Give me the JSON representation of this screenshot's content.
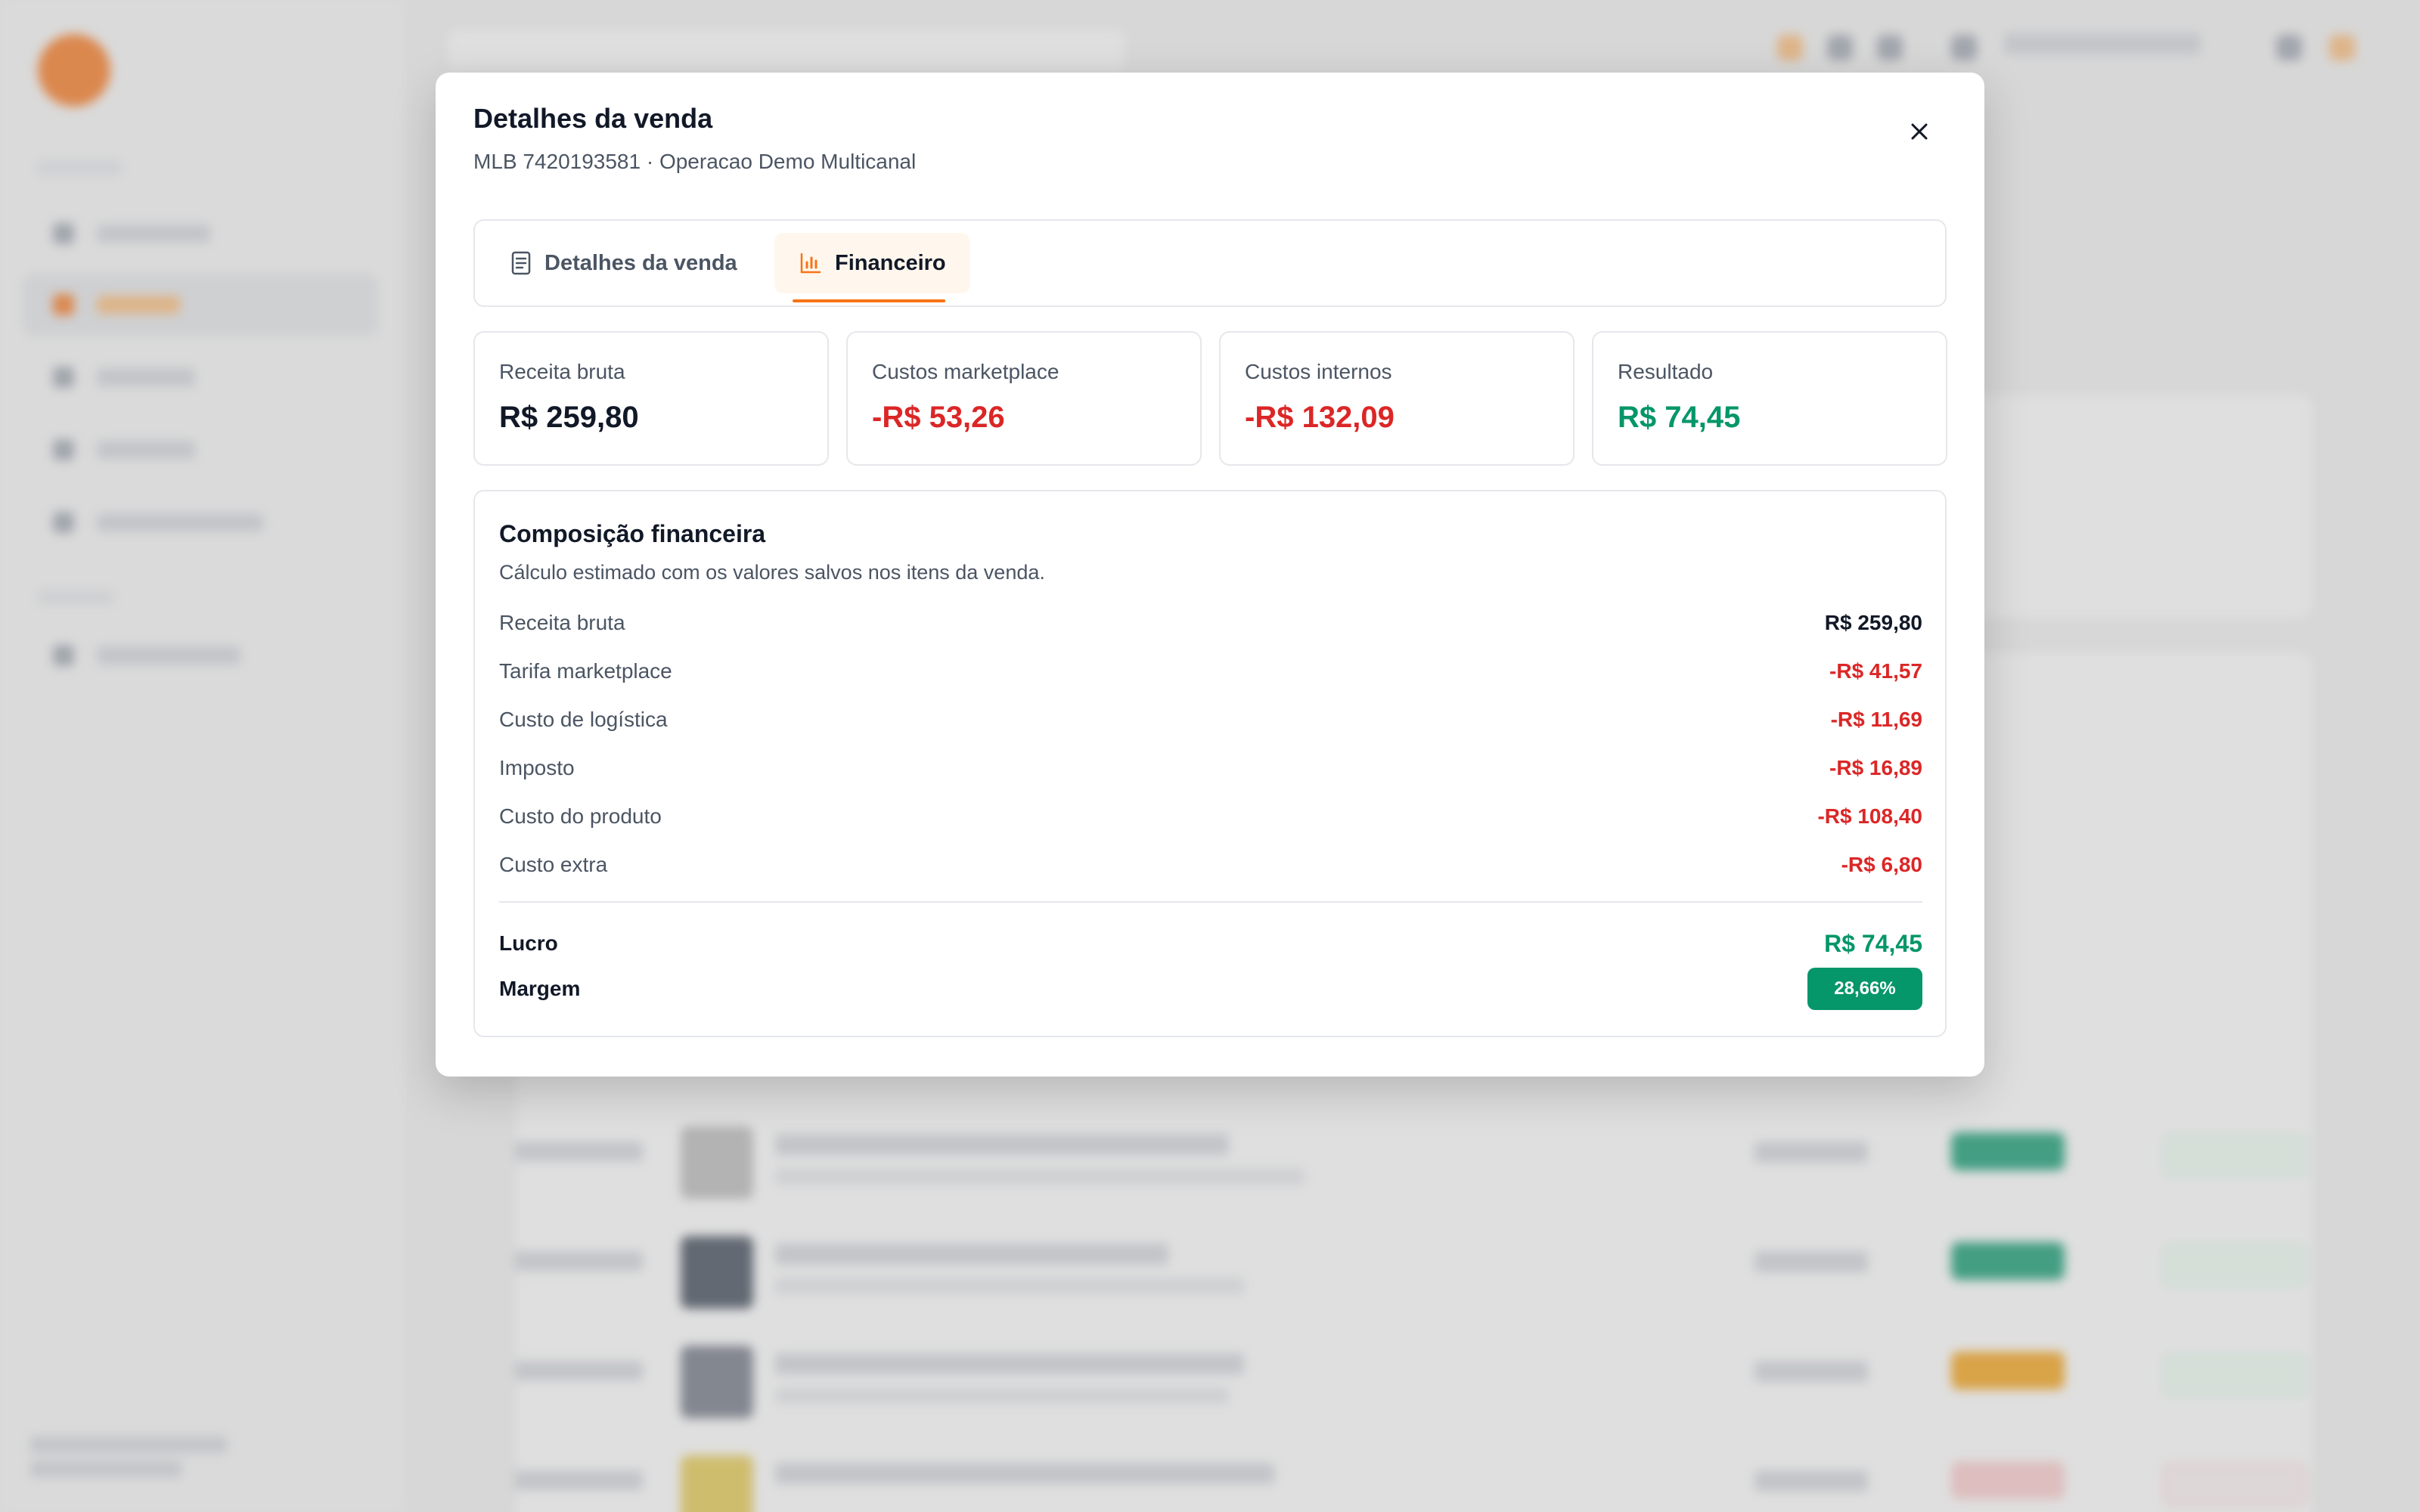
{
  "colors": {
    "accent": "#f97316",
    "positive": "#059669",
    "negative": "#dc2626",
    "text": "#111827",
    "muted": "#4b5563"
  },
  "modal": {
    "title": "Detalhes da venda",
    "subtitle": "MLB 7420193581 · Operacao Demo Multicanal",
    "close_icon": "close-icon",
    "tabs": [
      {
        "label": "Detalhes da venda",
        "icon": "document-icon",
        "active": false
      },
      {
        "label": "Financeiro",
        "icon": "bar-chart-icon",
        "active": true
      }
    ],
    "kpis": [
      {
        "label": "Receita bruta",
        "value": "R$ 259,80"
      },
      {
        "label": "Custos marketplace",
        "value": "-R$ 53,26"
      },
      {
        "label": "Custos internos",
        "value": "-R$ 132,09"
      },
      {
        "label": "Resultado",
        "value": "R$ 74,45"
      }
    ],
    "composition": {
      "title": "Composição financeira",
      "subtitle": "Cálculo estimado com os valores salvos nos itens da venda.",
      "lines": [
        {
          "label": "Receita bruta",
          "value": "R$ 259,80"
        },
        {
          "label": "Tarifa marketplace",
          "value": "-R$ 41,57"
        },
        {
          "label": "Custo de logística",
          "value": "-R$ 11,69"
        },
        {
          "label": "Imposto",
          "value": "-R$ 16,89"
        },
        {
          "label": "Custo do produto",
          "value": "-R$ 108,40"
        },
        {
          "label": "Custo extra",
          "value": "-R$ 6,80"
        }
      ],
      "profit_label": "Lucro",
      "profit_value": "R$ 74,45",
      "margin_label": "Margem",
      "margin_value": "28,66%"
    }
  }
}
